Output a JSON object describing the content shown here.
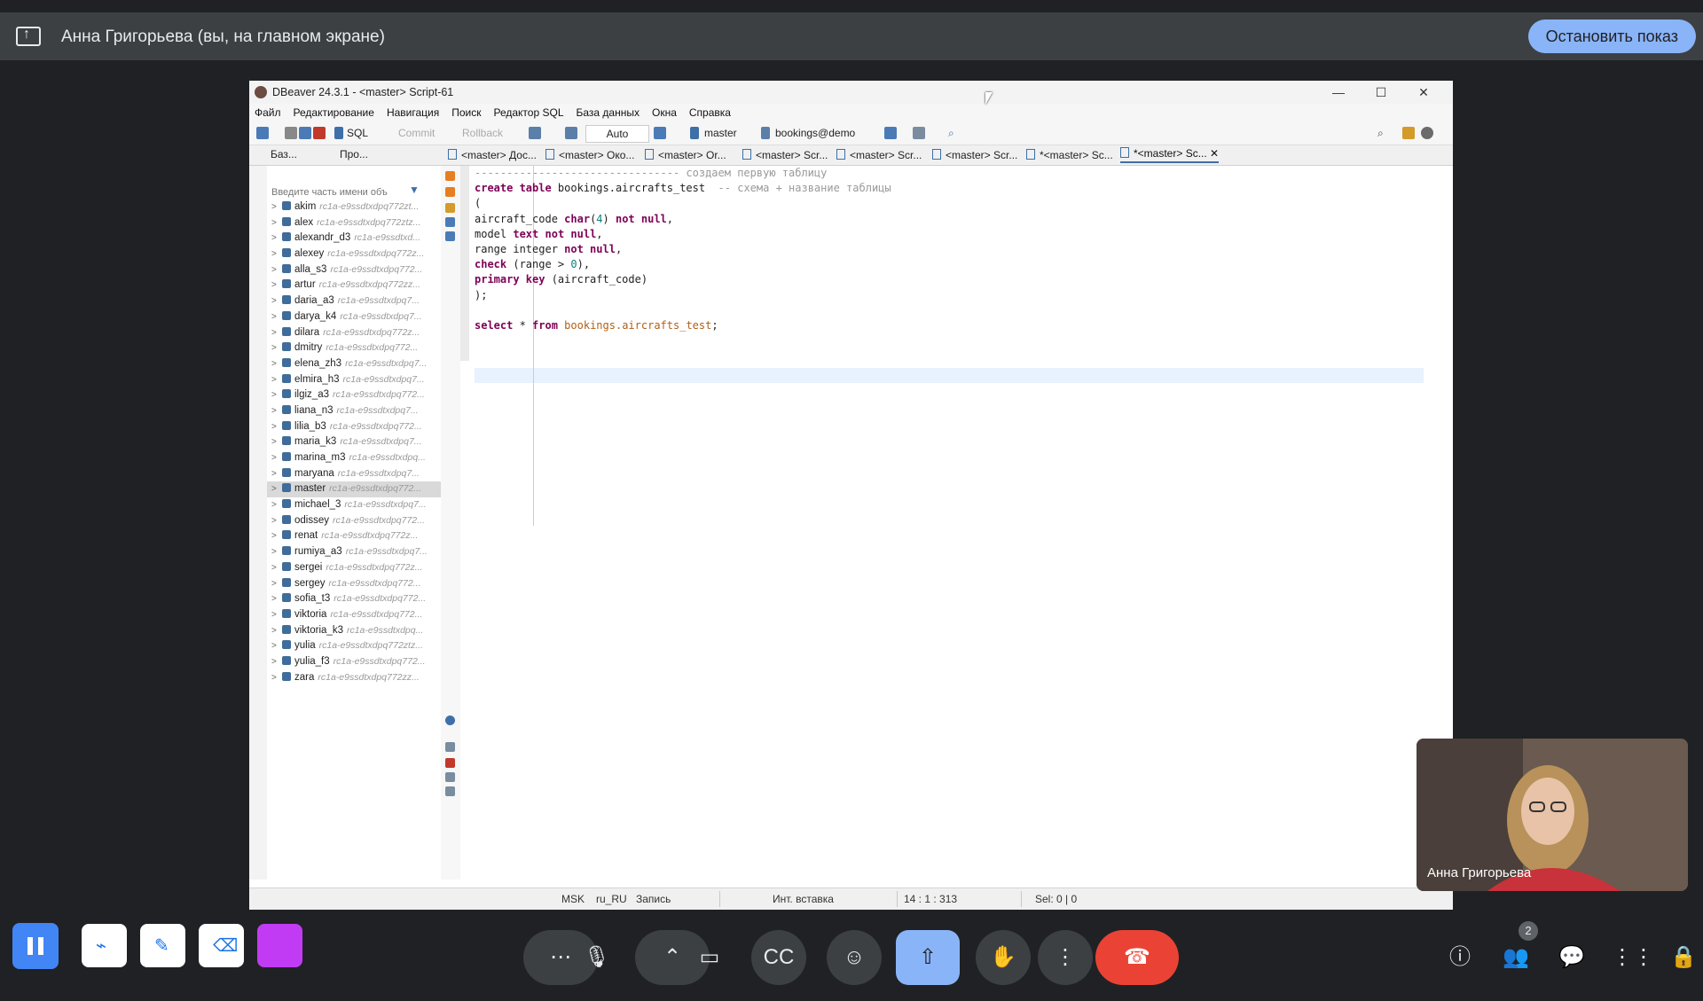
{
  "banner": {
    "presenter_text": "Анна Григорьева (вы, на главном экране)",
    "stop_button": "Остановить показ"
  },
  "window": {
    "title": "DBeaver 24.3.1 - <master> Script-61",
    "controls": [
      "—",
      "☐",
      "✕"
    ]
  },
  "menu": [
    "Файл",
    "Редактирование",
    "Навигация",
    "Поиск",
    "Редактор SQL",
    "База данных",
    "Окна",
    "Справка"
  ],
  "toolbar": {
    "sql": "SQL",
    "commit": "Commit",
    "rollback": "Rollback",
    "auto": "Auto",
    "datasource": "master",
    "schema": "bookings@demo"
  },
  "left_tabs": [
    "Баз...",
    "Про..."
  ],
  "navigator": {
    "filter_placeholder": "Введите часть имени объ",
    "connections": [
      {
        "name": "akim",
        "conn": "rc1a-e9ssdtxdpq772zt..."
      },
      {
        "name": "alex",
        "conn": "rc1a-e9ssdtxdpq772ztz..."
      },
      {
        "name": "alexandr_d3",
        "conn": "rc1a-e9ssdtxd..."
      },
      {
        "name": "alexey",
        "conn": "rc1a-e9ssdtxdpq772z..."
      },
      {
        "name": "alla_s3",
        "conn": "rc1a-e9ssdtxdpq772..."
      },
      {
        "name": "artur",
        "conn": "rc1a-e9ssdtxdpq772zz..."
      },
      {
        "name": "daria_a3",
        "conn": "rc1a-e9ssdtxdpq7..."
      },
      {
        "name": "darya_k4",
        "conn": "rc1a-e9ssdtxdpq7..."
      },
      {
        "name": "dilara",
        "conn": "rc1a-e9ssdtxdpq772z..."
      },
      {
        "name": "dmitry",
        "conn": "rc1a-e9ssdtxdpq772..."
      },
      {
        "name": "elena_zh3",
        "conn": "rc1a-e9ssdtxdpq7..."
      },
      {
        "name": "elmira_h3",
        "conn": "rc1a-e9ssdtxdpq7..."
      },
      {
        "name": "ilgiz_a3",
        "conn": "rc1a-e9ssdtxdpq772..."
      },
      {
        "name": "liana_n3",
        "conn": "rc1a-e9ssdtxdpq7..."
      },
      {
        "name": "lilia_b3",
        "conn": "rc1a-e9ssdtxdpq772..."
      },
      {
        "name": "maria_k3",
        "conn": "rc1a-e9ssdtxdpq7..."
      },
      {
        "name": "marina_m3",
        "conn": "rc1a-e9ssdtxdpq..."
      },
      {
        "name": "maryana",
        "conn": "rc1a-e9ssdtxdpq7..."
      },
      {
        "name": "master",
        "conn": "rc1a-e9ssdtxdpq772..."
      },
      {
        "name": "michael_3",
        "conn": "rc1a-e9ssdtxdpq7..."
      },
      {
        "name": "odissey",
        "conn": "rc1a-e9ssdtxdpq772..."
      },
      {
        "name": "renat",
        "conn": "rc1a-e9ssdtxdpq772z..."
      },
      {
        "name": "rumiya_a3",
        "conn": "rc1a-e9ssdtxdpq7..."
      },
      {
        "name": "sergei",
        "conn": "rc1a-e9ssdtxdpq772z..."
      },
      {
        "name": "sergey",
        "conn": "rc1a-e9ssdtxdpq772..."
      },
      {
        "name": "sofia_t3",
        "conn": "rc1a-e9ssdtxdpq772..."
      },
      {
        "name": "viktoria",
        "conn": "rc1a-e9ssdtxdpq772..."
      },
      {
        "name": "viktoria_k3",
        "conn": "rc1a-e9ssdtxdpq..."
      },
      {
        "name": "yulia",
        "conn": "rc1a-e9ssdtxdpq772ztz..."
      },
      {
        "name": "yulia_f3",
        "conn": "rc1a-e9ssdtxdpq772..."
      },
      {
        "name": "zara",
        "conn": "rc1a-e9ssdtxdpq772zz..."
      }
    ],
    "selected": "master"
  },
  "editor_tabs": [
    "<master> Дос...",
    "<master> Око...",
    "<master> Or...",
    "<master> Scr...",
    "<master> Scr...",
    "<master> Scr...",
    "*<master> Sc...",
    "*<master> Sc..."
  ],
  "code_lines": {
    "l1_comment": "-------------------------------- создаем первую таблицу",
    "l2_kw": "create table",
    "l2_name": " bookings.aircrafts_test  ",
    "l2_comment": "-- схема + название таблицы",
    "l3": "(",
    "l4_a": "aircraft_code ",
    "l4_type": "char",
    "l4_b": "(",
    "l4_num": "4",
    "l4_c": ") ",
    "l4_kw": "not null",
    "l4_d": ",",
    "l5_a": "model ",
    "l5_type": "text",
    "l5_b": " ",
    "l5_kw": "not null",
    "l5_c": ",",
    "l6_a": "range integer ",
    "l6_kw": "not null",
    "l6_b": ",",
    "l7_kw": "check",
    "l7_a": " (range > ",
    "l7_num": "0",
    "l7_b": "),",
    "l8_kw": "primary key",
    "l8_a": " (aircraft_code)",
    "l9": ");",
    "l11_kw1": "select",
    "l11_a": " * ",
    "l11_kw2": "from",
    "l11_tbl": " bookings.aircrafts_test",
    "l11_b": ";"
  },
  "status": {
    "tz": "MSK",
    "locale": "ru_RU",
    "mode": "Запись",
    "insert": "Инт. вставка",
    "pos": "14 : 1 : 313",
    "sel": "Sel: 0 | 0"
  },
  "video": {
    "name": "Анна Григорьева"
  },
  "participants_count": "2",
  "icons": {
    "more": "more-horiz-icon",
    "mic": "mic-icon",
    "chevron": "chevron-up-icon",
    "camera": "videocam-icon",
    "captions": "closed-caption-icon",
    "emoji": "emoji-icon",
    "present": "present-to-all-icon",
    "hand": "raise-hand-icon",
    "kebab": "more-vert-icon",
    "hangup": "call-end-icon",
    "info": "info-icon",
    "people": "people-icon",
    "chat": "chat-icon",
    "apps": "apps-icon",
    "lock": "lock-person-icon"
  },
  "colors": {
    "accent_blue": "#8ab4f8",
    "hangup_red": "#ea4335",
    "annot_purple": "#c23bf4",
    "pause_blue": "#4285f4"
  }
}
